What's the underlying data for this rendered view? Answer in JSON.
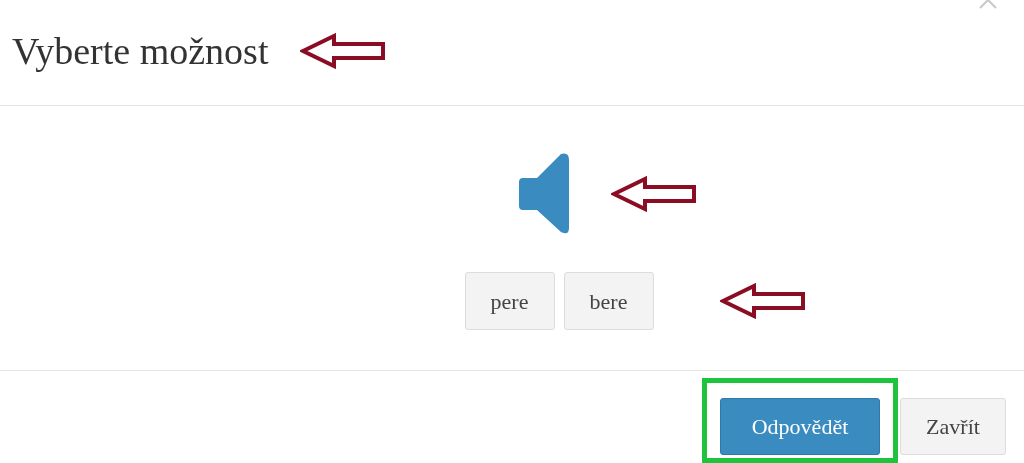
{
  "dialog": {
    "title": "Vyberte možnost"
  },
  "options": [
    {
      "label": "pere",
      "selected": false
    },
    {
      "label": "bere",
      "selected": false
    }
  ],
  "footer_buttons": [
    {
      "label": "Odpovědět",
      "kind": "primary",
      "highlighted": true
    },
    {
      "label": "Zavřít",
      "kind": "secondary",
      "highlighted": false
    }
  ]
}
